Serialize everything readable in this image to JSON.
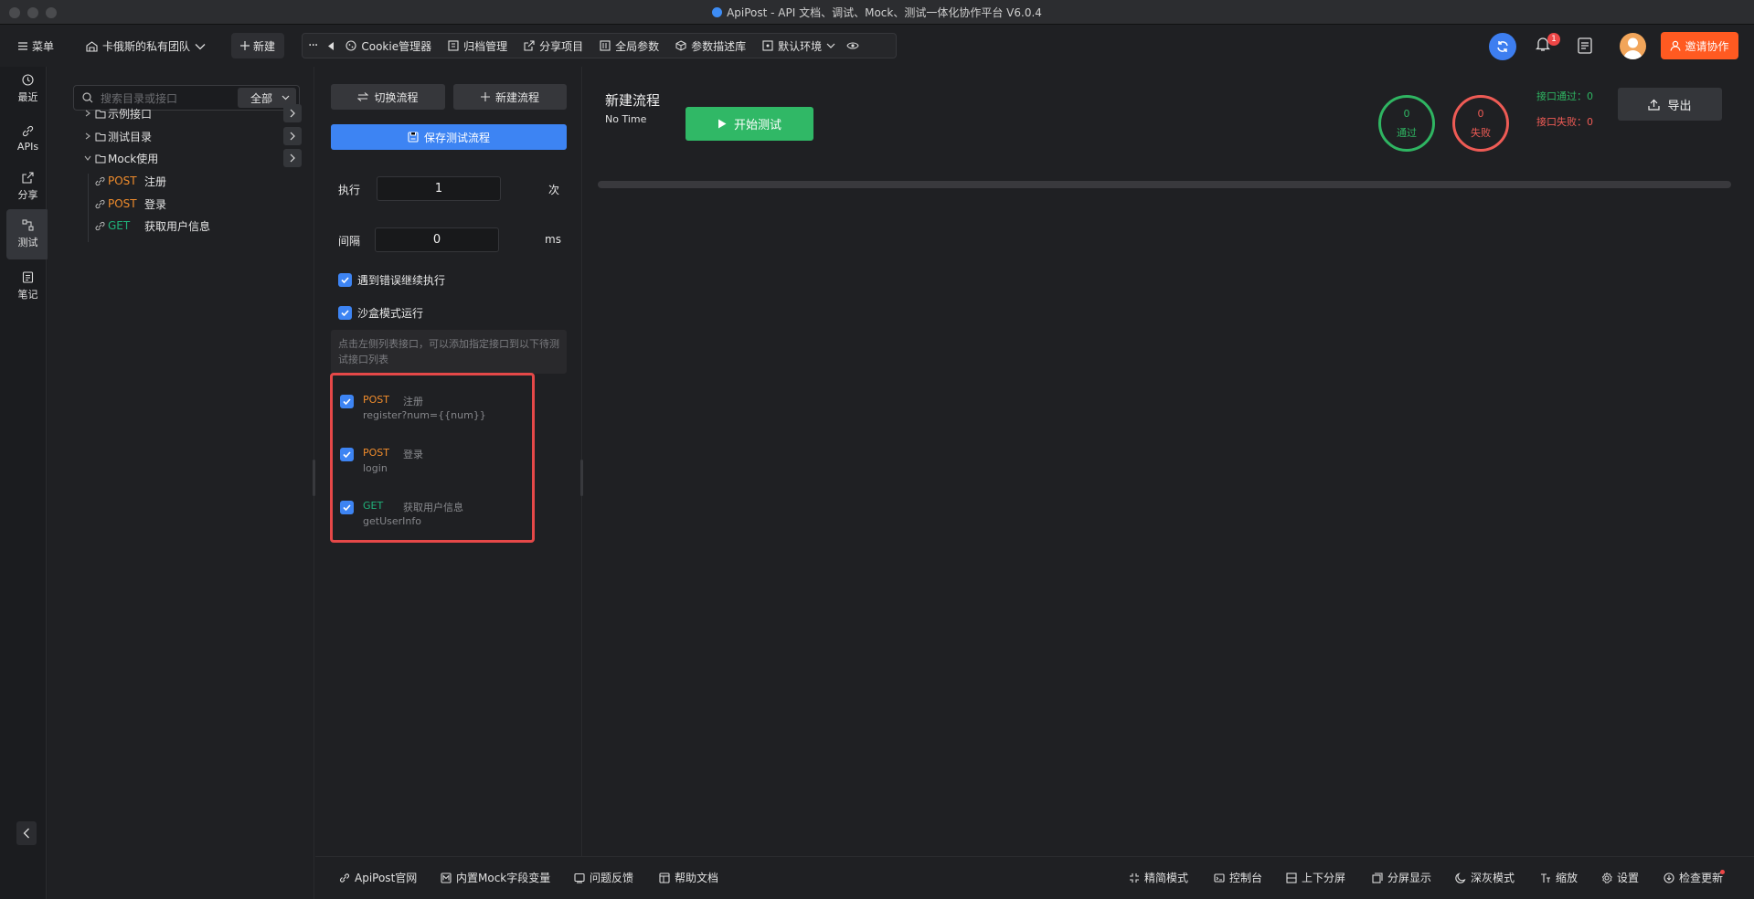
{
  "window": {
    "title": "ApiPost - API 文档、调试、Mock、测试一体化协作平台 V6.0.4"
  },
  "toolbar": {
    "menu_label": "菜单",
    "team_label": "卡俄斯的私有团队",
    "new_label": "新建",
    "tools": [
      {
        "label": "Cookie管理器",
        "icon": "cookie-icon"
      },
      {
        "label": "归档管理",
        "icon": "archive-icon"
      },
      {
        "label": "分享项目",
        "icon": "share-icon"
      },
      {
        "label": "全局参数",
        "icon": "params-icon"
      },
      {
        "label": "参数描述库",
        "icon": "cube-icon"
      },
      {
        "label": "默认环境",
        "icon": "env-icon"
      }
    ],
    "notification_count": "1",
    "invite_label": "邀请协作"
  },
  "rail": {
    "items": [
      {
        "label": "最近",
        "icon": "clock-icon"
      },
      {
        "label": "APIs",
        "icon": "link-icon"
      },
      {
        "label": "分享",
        "icon": "share-icon"
      },
      {
        "label": "测试",
        "icon": "flow-icon"
      },
      {
        "label": "笔记",
        "icon": "note-icon"
      }
    ],
    "active": "测试"
  },
  "tree": {
    "search_placeholder": "搜索目录或接口",
    "filter_value": "全部",
    "folders": [
      {
        "label": "示例接口",
        "expanded": false
      },
      {
        "label": "测试目录",
        "expanded": false
      },
      {
        "label": "Mock使用",
        "expanded": true
      }
    ],
    "apis": [
      {
        "method": "POST",
        "name": "注册"
      },
      {
        "method": "POST",
        "name": "登录"
      },
      {
        "method": "GET",
        "name": "获取用户信息"
      }
    ]
  },
  "config": {
    "switch_flow_label": "切换流程",
    "new_flow_label": "新建流程",
    "save_flow_label": "保存测试流程",
    "exec_label": "执行",
    "exec_value": "1",
    "exec_unit": "次",
    "interval_label": "间隔",
    "interval_value": "0",
    "interval_unit": "ms",
    "continue_on_error_label": "遇到错误继续执行",
    "sandbox_label": "沙盒模式运行",
    "hint": "点击左侧列表接口，可以添加指定接口到以下待测试接口列表",
    "queue": [
      {
        "method": "POST",
        "name": "注册",
        "path": "register?num={{num}}"
      },
      {
        "method": "POST",
        "name": "登录",
        "path": "login"
      },
      {
        "method": "GET",
        "name": "获取用户信息",
        "path": "getUserInfo"
      }
    ]
  },
  "main": {
    "flow_title": "新建流程",
    "flow_time": "No Time",
    "start_label": "开始测试",
    "pass_count": "0",
    "pass_label": "通过",
    "fail_count": "0",
    "fail_label": "失败",
    "api_pass": "接口通过：0",
    "api_fail": "接口失败：0",
    "export_label": "导出",
    "progress": 0
  },
  "bottom": {
    "left": [
      {
        "label": "ApiPost官网",
        "icon": "link-icon"
      },
      {
        "label": "内置Mock字段变量",
        "icon": "mock-icon"
      },
      {
        "label": "问题反馈",
        "icon": "feedback-icon"
      },
      {
        "label": "帮助文档",
        "icon": "help-doc-icon"
      }
    ],
    "right": [
      {
        "label": "精简模式",
        "icon": "compress-icon"
      },
      {
        "label": "控制台",
        "icon": "console-icon"
      },
      {
        "label": "上下分屏",
        "icon": "split-v-icon"
      },
      {
        "label": "分屏显示",
        "icon": "split-icon"
      },
      {
        "label": "深灰模式",
        "icon": "moon-icon"
      },
      {
        "label": "缩放",
        "icon": "font-size-icon"
      },
      {
        "label": "设置",
        "icon": "settings-icon"
      },
      {
        "label": "检查更新",
        "icon": "update-icon"
      }
    ]
  },
  "colors": {
    "accent": "#3d84f3",
    "post": "#f08c2c",
    "get": "#20b27a",
    "pass": "#2fb562",
    "fail": "#ee5b55",
    "invite": "#ff5a21",
    "highlight_border": "#e54848"
  }
}
